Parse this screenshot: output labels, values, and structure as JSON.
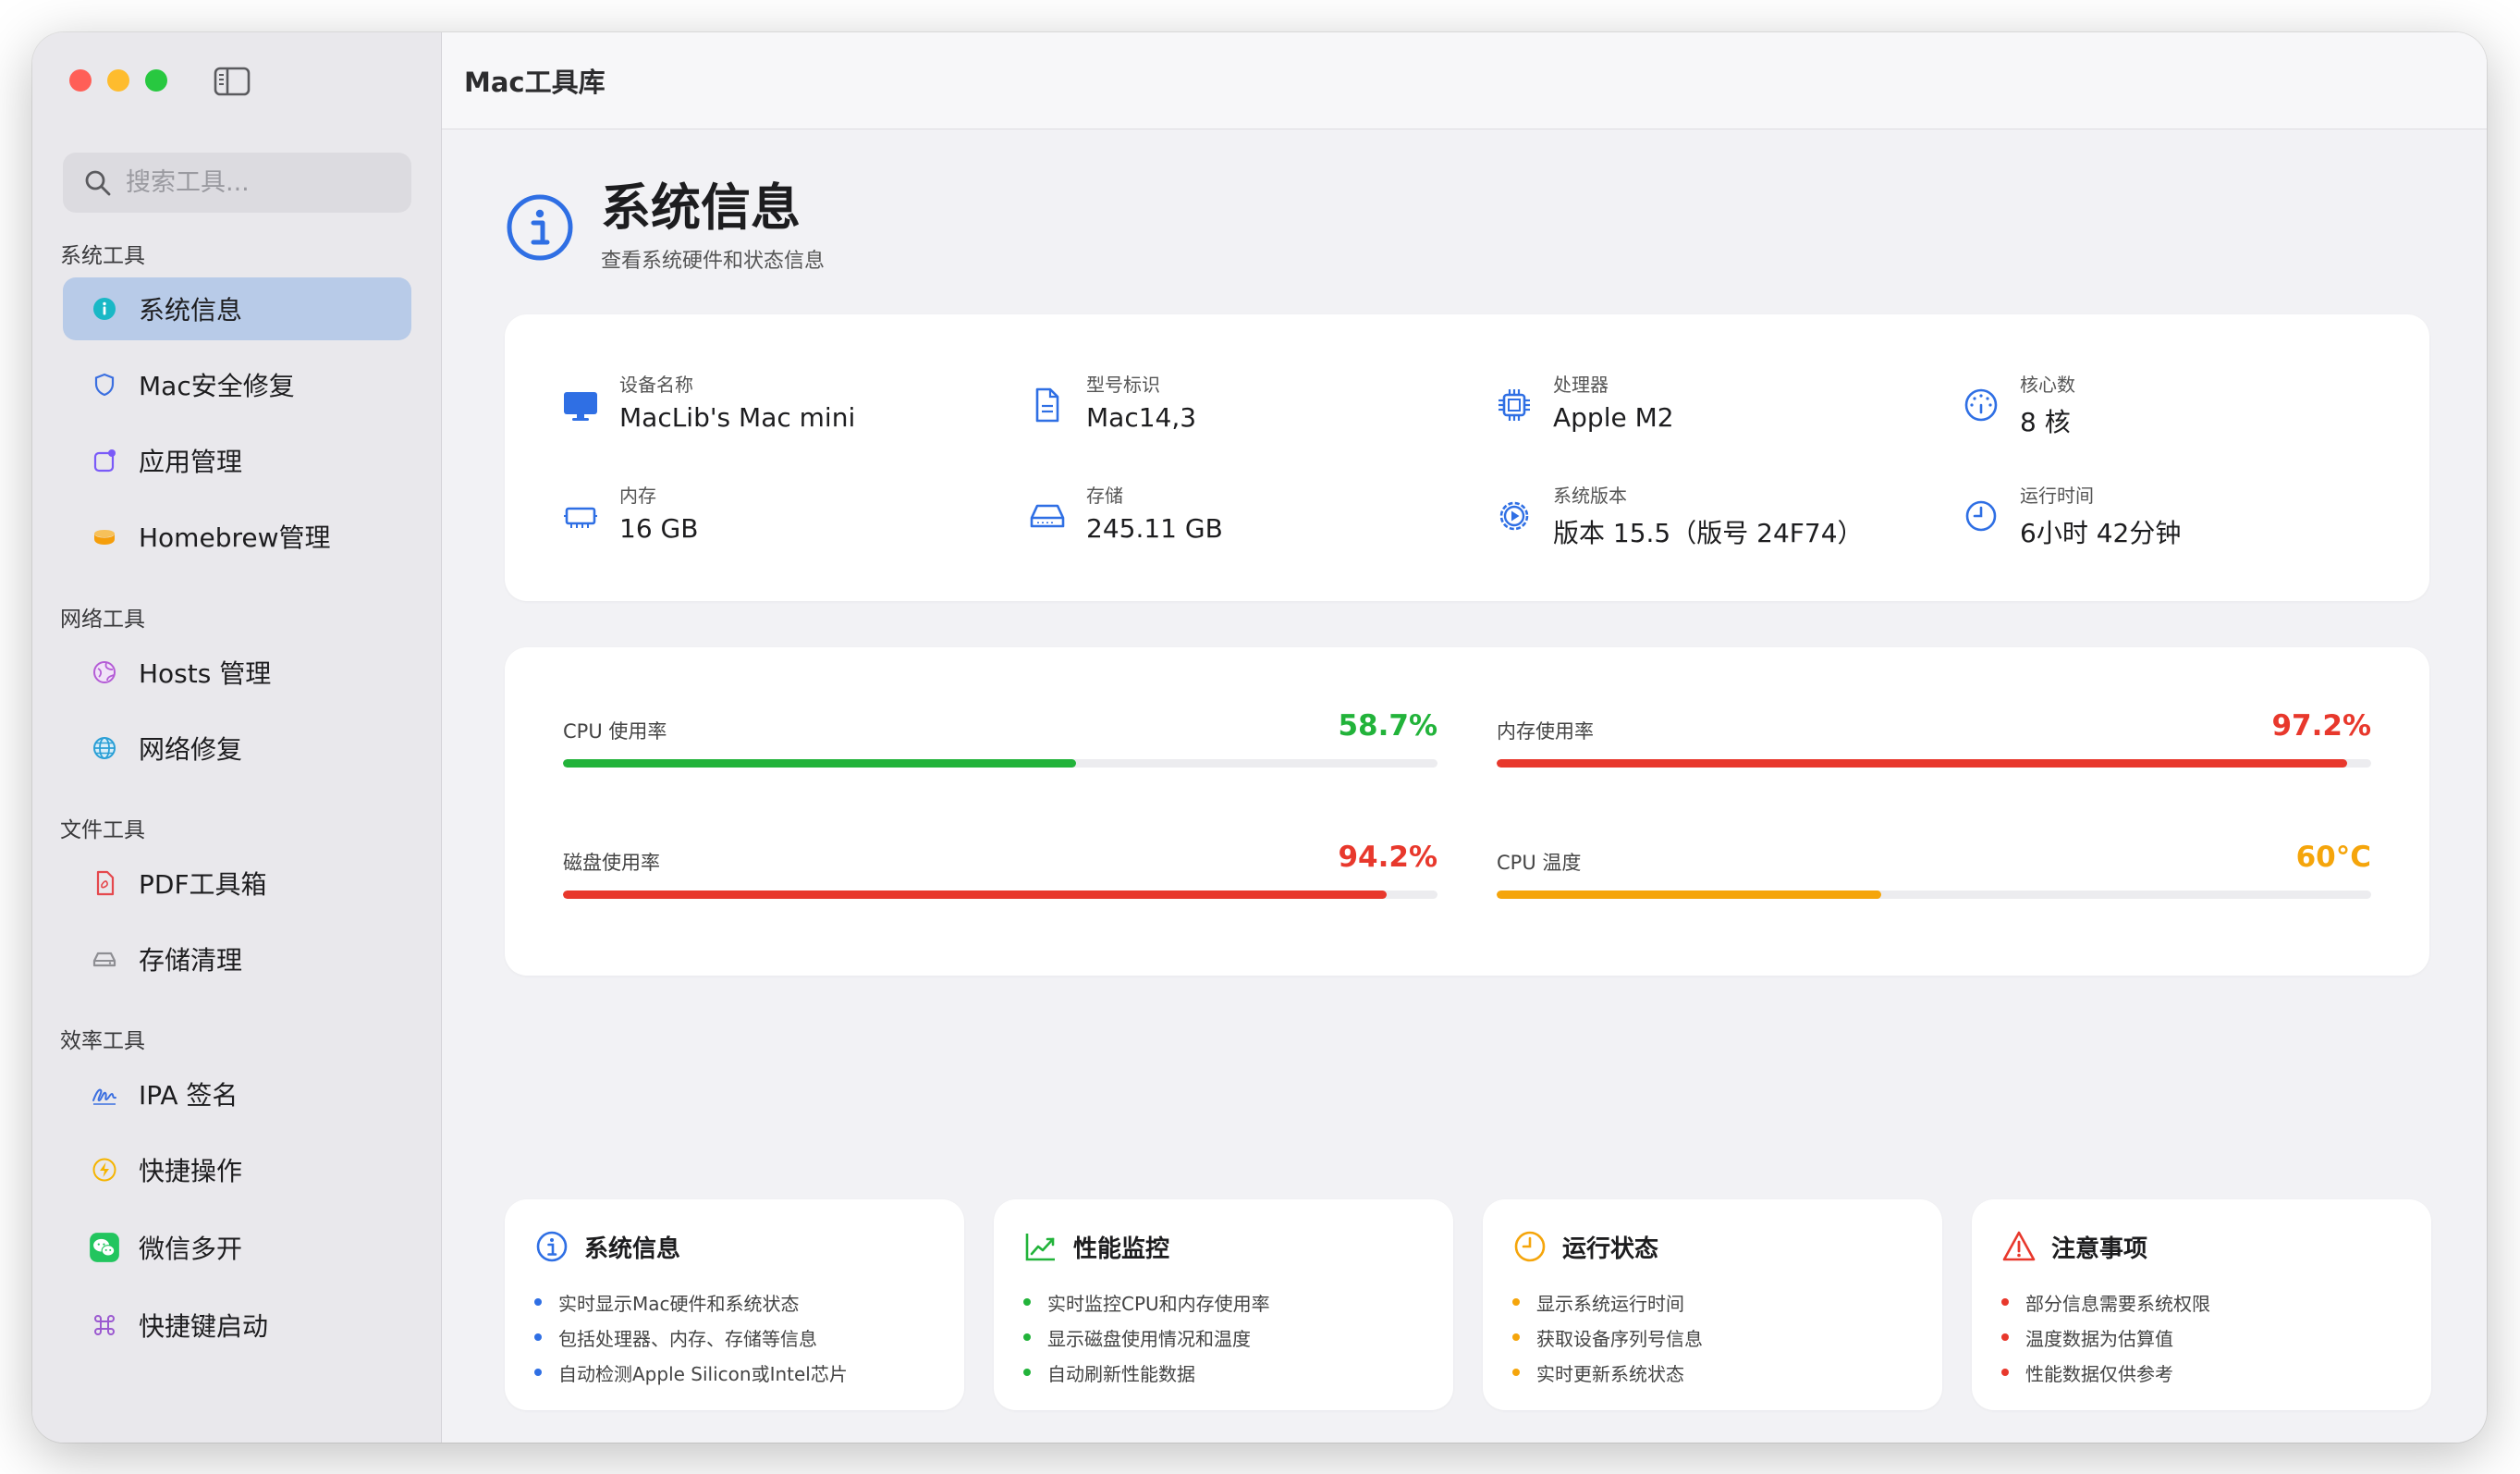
{
  "app": {
    "title": "Mac工具库"
  },
  "search": {
    "placeholder": "搜索工具..."
  },
  "sidebar": {
    "sections": [
      {
        "title": "系统工具",
        "items": [
          {
            "label": "系统信息",
            "icon": "info-circle-icon",
            "color": "#19b8c6",
            "active": true
          },
          {
            "label": "Mac安全修复",
            "icon": "shield-icon",
            "color": "#3b6fe0"
          },
          {
            "label": "应用管理",
            "icon": "app-window-icon",
            "color": "#7a5af8"
          },
          {
            "label": "Homebrew管理",
            "icon": "homebrew-mug-icon",
            "color": "#f59e0b"
          }
        ]
      },
      {
        "title": "网络工具",
        "items": [
          {
            "label": "Hosts 管理",
            "icon": "globe-icon",
            "color": "#b45cd6"
          },
          {
            "label": "网络修复",
            "icon": "network-globe-icon",
            "color": "#2a9fd6"
          }
        ]
      },
      {
        "title": "文件工具",
        "items": [
          {
            "label": "PDF工具箱",
            "icon": "pdf-file-icon",
            "color": "#e5484d"
          },
          {
            "label": "存储清理",
            "icon": "disk-drive-icon",
            "color": "#8e8e93"
          }
        ]
      },
      {
        "title": "效率工具",
        "items": [
          {
            "label": "IPA 签名",
            "icon": "signature-icon",
            "color": "#3b6fe0"
          },
          {
            "label": "快捷操作",
            "icon": "lightning-icon",
            "color": "#f5b400"
          },
          {
            "label": "微信多开",
            "icon": "wechat-icon",
            "color": "#22c55e"
          },
          {
            "label": "快捷键启动",
            "icon": "command-key-icon",
            "color": "#9b59d0"
          }
        ]
      }
    ]
  },
  "page": {
    "title": "系统信息",
    "subtitle": "查看系统硬件和状态信息"
  },
  "info": [
    {
      "label": "设备名称",
      "value": "MacLib's Mac mini",
      "icon": "desktop-icon"
    },
    {
      "label": "型号标识",
      "value": "Mac14,3",
      "icon": "document-icon"
    },
    {
      "label": "处理器",
      "value": "Apple M2",
      "icon": "cpu-chip-icon"
    },
    {
      "label": "核心数",
      "value": "8 核",
      "icon": "gauge-icon"
    },
    {
      "label": "内存",
      "value": "16 GB",
      "icon": "memory-icon"
    },
    {
      "label": "存储",
      "value": "245.11 GB",
      "icon": "storage-drive-icon"
    },
    {
      "label": "系统版本",
      "value": "版本 15.5（版号 24F74）",
      "icon": "gear-play-icon"
    },
    {
      "label": "运行时间",
      "value": "6小时 42分钟",
      "icon": "clock-icon"
    }
  ],
  "usage": [
    {
      "label": "CPU 使用率",
      "value_text": "58.7%",
      "fraction": 0.587,
      "color": "#22b33a"
    },
    {
      "label": "内存使用率",
      "value_text": "97.2%",
      "fraction": 0.972,
      "color": "#e8382c"
    },
    {
      "label": "磁盘使用率",
      "value_text": "94.2%",
      "fraction": 0.942,
      "color": "#e8382c"
    },
    {
      "label": "CPU 温度",
      "value_text": "60°C",
      "fraction": 0.44,
      "color": "#f5a50b"
    }
  ],
  "features": [
    {
      "title": "系统信息",
      "icon": "info-circle-icon",
      "color": "#2f6fe4",
      "items": [
        "实时显示Mac硬件和系统状态",
        "包括处理器、内存、存储等信息",
        "自动检测Apple Silicon或Intel芯片"
      ]
    },
    {
      "title": "性能监控",
      "icon": "chart-line-icon",
      "color": "#22b33a",
      "items": [
        "实时监控CPU和内存使用率",
        "显示磁盘使用情况和温度",
        "自动刷新性能数据"
      ]
    },
    {
      "title": "运行状态",
      "icon": "clock-icon",
      "color": "#f5a50b",
      "items": [
        "显示系统运行时间",
        "获取设备序列号信息",
        "实时更新系统状态"
      ]
    },
    {
      "title": "注意事项",
      "icon": "warning-triangle-icon",
      "color": "#e8382c",
      "items": [
        "部分信息需要系统权限",
        "温度数据为估算值",
        "性能数据仅供参考"
      ]
    }
  ]
}
